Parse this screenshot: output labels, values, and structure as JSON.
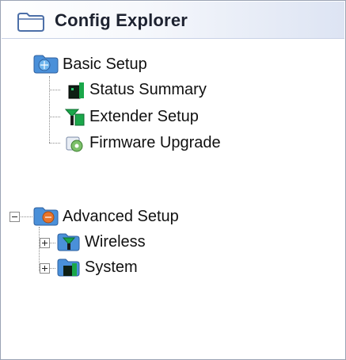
{
  "header": {
    "title": "Config Explorer",
    "icon": "folder-icon"
  },
  "tree": {
    "basic_setup": {
      "label": "Basic Setup",
      "icon": "network-folder-icon",
      "children": [
        {
          "label": "Status Summary",
          "icon": "status-device-icon"
        },
        {
          "label": "Extender Setup",
          "icon": "extender-antenna-icon"
        },
        {
          "label": "Firmware Upgrade",
          "icon": "firmware-disc-icon"
        }
      ]
    },
    "advanced_setup": {
      "label": "Advanced Setup",
      "icon": "network-folder-icon",
      "expanded": true,
      "children": [
        {
          "label": "Wireless",
          "icon": "wireless-folder-icon",
          "expanded": false
        },
        {
          "label": "System",
          "icon": "system-folder-icon",
          "expanded": false
        }
      ]
    }
  }
}
